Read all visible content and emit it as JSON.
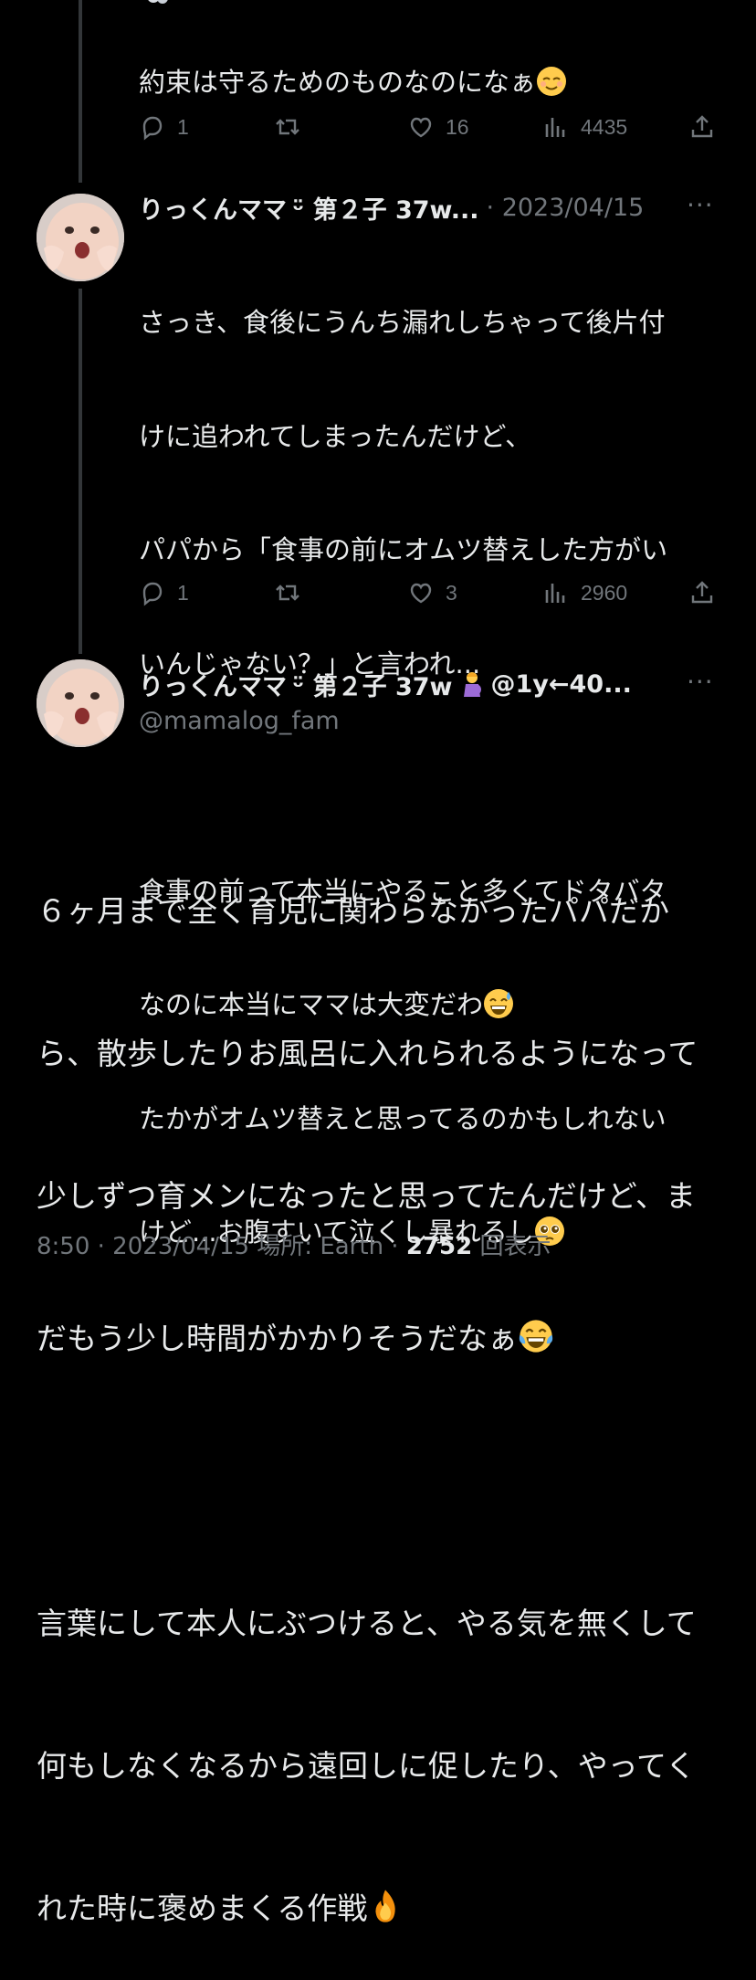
{
  "tweet1": {
    "text": "約束は守るためのものなのになぁ",
    "emoji": "relieved-face",
    "replies": "1",
    "retweets": "",
    "likes": "16",
    "views": "4435"
  },
  "tweet2": {
    "name": "りっくんママ",
    "name_suffix": "ᵕ̈ 第２子 37w...",
    "date": "· 2023/04/15",
    "more": "···",
    "line1": "さっき、食後にうんち漏れしちゃって後片付",
    "line2": "けに追われてしまったんだけど、",
    "line3": "パパから「食事の前にオムツ替えした方がい",
    "line4": "いんじゃない？」と言われ...",
    "line5": "食事の前って本当にやること多くてドタバタ",
    "line6": "なのに本当にママは大変だわ",
    "line7": "たかがオムツ替えと思ってるのかもしれない",
    "line8": "けど...お腹すいて泣くし暴れるし",
    "replies": "1",
    "likes": "3",
    "views": "2960"
  },
  "tweet3": {
    "name": "りっくんママ",
    "name_suffix": "ᵕ̈ 第２子 37w",
    "name_tail": "@1y←40...",
    "handle": "@mamalog_fam",
    "more": "···",
    "line1": "６ヶ月まで全く育児に関わらなかったパパだか",
    "line2": "ら、散歩したりお風呂に入れられるようになって",
    "line3": "少しずつ育メンになったと思ってたんだけど、ま",
    "line4": "だもう少し時間がかかりそうだなぁ",
    "line5": "言葉にして本人にぶつけると、やる気を無くして",
    "line6": "何もしなくなるから遠回しに促したり、やってく",
    "line7": "れた時に褒めまくる作戦",
    "time": "8:50 · 2023/04/15 場所: Earth · ",
    "view_count": "2752",
    "view_label": " 回表示"
  },
  "colors": {
    "bg": "#000000",
    "text": "#e7e9ea",
    "muted": "#71767b",
    "line": "#333639"
  }
}
